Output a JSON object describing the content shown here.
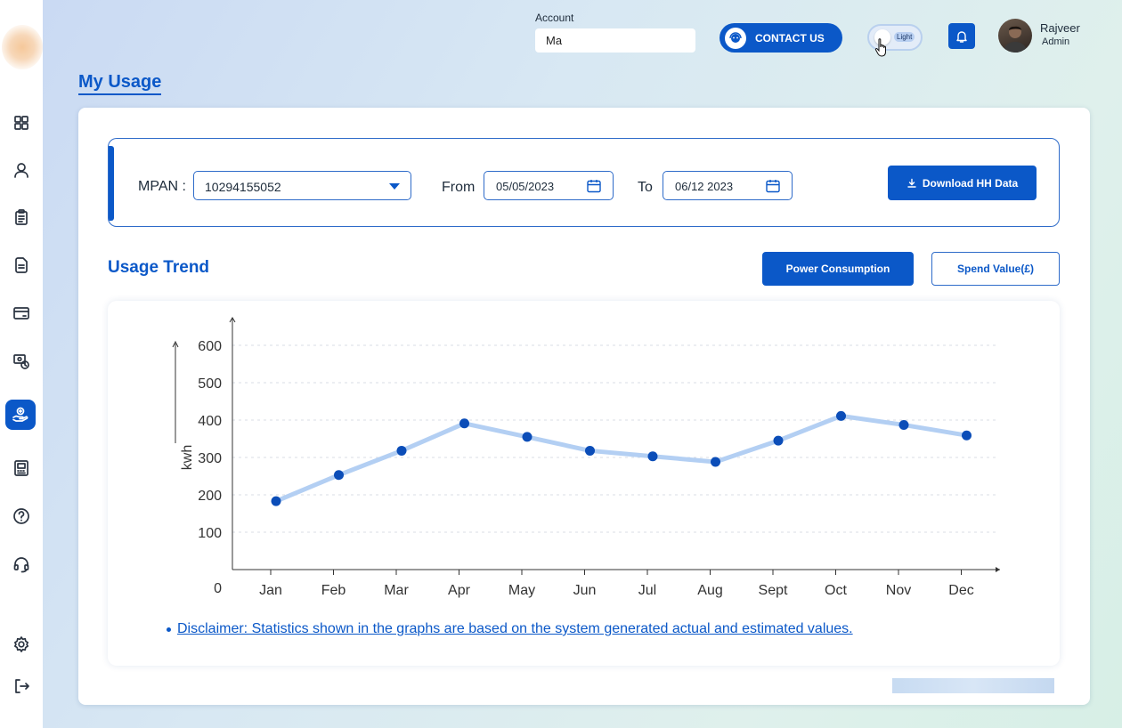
{
  "account": {
    "label": "Account",
    "value": "Ma"
  },
  "header": {
    "contact_label": "CONTACT US",
    "theme_label": "Light",
    "user_name": "Rajveer",
    "user_role": "Admin"
  },
  "page": {
    "title": "My Usage"
  },
  "filters": {
    "mpan_label": "MPAN :",
    "mpan_value": "10294155052",
    "from_label": "From",
    "from_date": "05/05/2023",
    "to_label": "To",
    "to_date": "06/12 2023",
    "download_label": "Download HH Data"
  },
  "usage": {
    "title": "Usage Trend",
    "power_label": "Power Consumption",
    "spend_label": "Spend Value(£)"
  },
  "chart_data": {
    "type": "line",
    "categories": [
      "Jan",
      "Feb",
      "Mar",
      "Apr",
      "May",
      "Jun",
      "Jul",
      "Aug",
      "Sept",
      "Oct",
      "Nov",
      "Dec"
    ],
    "values": [
      183,
      253,
      318,
      391,
      355,
      318,
      303,
      288,
      345,
      411,
      387,
      359
    ],
    "ylabel": "kwh",
    "ylim": [
      0,
      600
    ],
    "yticks": [
      0,
      100,
      200,
      300,
      400,
      500,
      600
    ],
    "grid": true,
    "line_color": "#b3cff3",
    "point_color": "#0b4db8"
  },
  "disclaimer": "Disclaimer: Statistics shown in the graphs are based on the system generated actual and estimated values.",
  "colors": {
    "accent": "#0b58c8",
    "sidebar_active": "#0b58c8"
  },
  "sidebar": {
    "icons": [
      "dashboard-icon",
      "user-icon",
      "clipboard-icon",
      "documents-icon",
      "card-icon",
      "billing-clock-icon",
      "usage-hand-icon",
      "meter-icon",
      "help-icon",
      "headset-icon",
      "settings-icon",
      "logout-icon"
    ],
    "active": "usage-hand-icon"
  }
}
